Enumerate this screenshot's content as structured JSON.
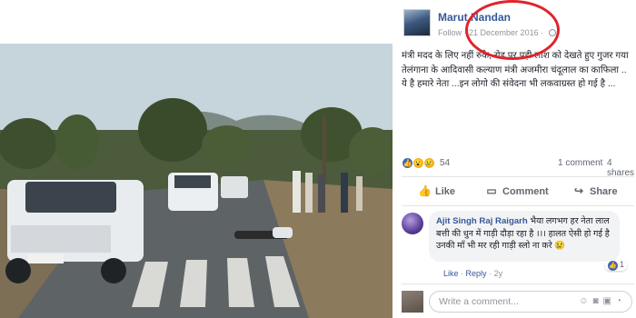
{
  "post": {
    "author": "Marut Nandan",
    "follow_label": "Follow",
    "date": "21 December 2016",
    "text": "मंत्री मदद के लिए नहीं रुके, रोड पर पड़ी लाश को देखते हुए गुजर गया तेलंगाना के आदिवासी कल्याण मंत्री अजमीरा चंदूलाल का काफिला .. ये है हमारे नेता ...इन लोगो की संवेदना भी लकवाग्रस्त हो गई है ...",
    "reactions_count": "54",
    "comments_count": "1 comment",
    "shares_count": "4 shares"
  },
  "actions": {
    "like": "Like",
    "comment": "Comment",
    "share": "Share"
  },
  "comment": {
    "author": "Ajit Singh Raj Raigarh",
    "text": "भैया लगभग हर नेता लाल बत्ती की धुन में गाड़ी दौड़ा रहा है ।।। हालत ऐसी हो गई है उनकी माँ भी मर रही गाड़ी स्लो ना करे 😢",
    "like_count": "1",
    "like_label": "Like",
    "reply_label": "Reply",
    "age": "2y"
  },
  "composer": {
    "placeholder": "Write a comment...",
    "icons": [
      "emoji-icon",
      "camera-icon",
      "gif-icon",
      "sticker-icon"
    ]
  },
  "colors": {
    "link": "#365899",
    "highlight_circle": "#e0232b",
    "like_blue": "#4267b2"
  }
}
